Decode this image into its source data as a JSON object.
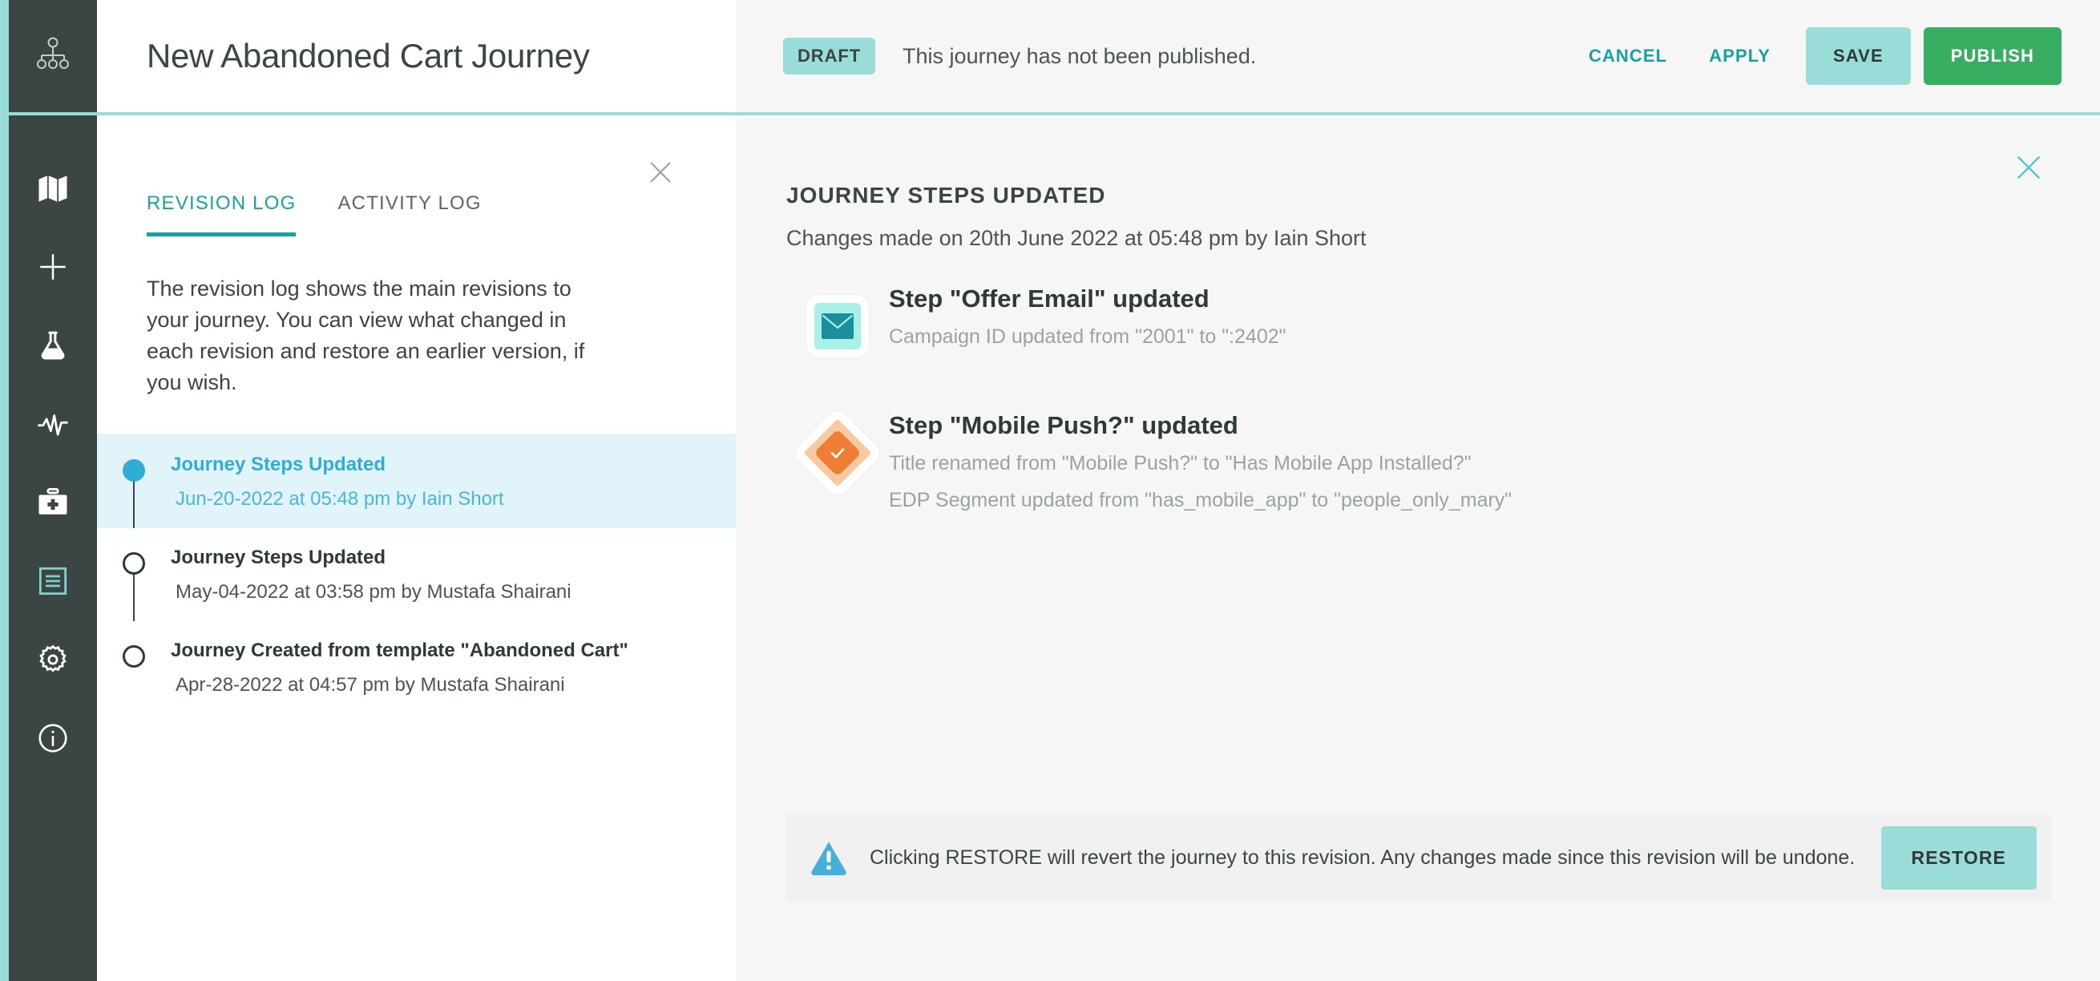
{
  "accent_colors": {
    "teal": "#9adcd8",
    "teal_dark": "#19a0a0",
    "green": "#38ae62",
    "dark": "#3b4544",
    "blue": "#2fadd6",
    "selected_row_bg": "#e1f4fa",
    "orange": "#ef7e35",
    "orange_light": "#f9c9a0"
  },
  "rail": {
    "logo_icon": "org-chart-icon",
    "items": [
      {
        "icon": "map-icon",
        "name": "map",
        "active": false
      },
      {
        "icon": "plus-icon",
        "name": "add",
        "active": false
      },
      {
        "icon": "flask-icon",
        "name": "experiments",
        "active": false
      },
      {
        "icon": "pulse-icon",
        "name": "analytics",
        "active": false
      },
      {
        "icon": "briefcase-medical-icon",
        "name": "toolkit",
        "active": false
      },
      {
        "icon": "log-list-icon",
        "name": "logs",
        "active": true
      },
      {
        "icon": "gear-icon",
        "name": "settings",
        "active": false
      },
      {
        "icon": "info-circle-icon",
        "name": "info",
        "active": false
      }
    ]
  },
  "header": {
    "title": "New Abandoned Cart Journey",
    "status_badge": "DRAFT",
    "publish_note": "This journey has not been published.",
    "cancel_label": "CANCEL",
    "apply_label": "APPLY",
    "save_label": "SAVE",
    "publish_label": "PUBLISH"
  },
  "side_panel": {
    "close_icon": "close-icon",
    "tabs": [
      {
        "label": "REVISION LOG",
        "active": true
      },
      {
        "label": "ACTIVITY LOG",
        "active": false
      }
    ],
    "description": "The revision log shows the main revisions to your journey. You can view what changed in each revision and restore an earlier version, if you wish.",
    "revisions": [
      {
        "title": "Journey Steps Updated",
        "meta": "Jun-20-2022 at 05:48 pm by Iain Short",
        "selected": true
      },
      {
        "title": "Journey Steps Updated",
        "meta": "May-04-2022 at 03:58 pm by Mustafa Shairani",
        "selected": false
      },
      {
        "title": "Journey Created from template \"Abandoned Cart\"",
        "meta": "Apr-28-2022 at 04:57 pm by Mustafa Shairani",
        "selected": false
      }
    ]
  },
  "main": {
    "close_icon": "close-icon",
    "title": "JOURNEY STEPS UPDATED",
    "subtitle": "Changes made on 20th June 2022 at 05:48 pm by Iain Short",
    "changes": [
      {
        "icon": "email-step-icon",
        "title": "Step \"Offer Email\" updated",
        "details": [
          "Campaign ID updated from \"2001\" to \":2402\""
        ]
      },
      {
        "icon": "decision-diamond-icon",
        "title": "Step \"Mobile Push?\" updated",
        "details": [
          "Title renamed from \"Mobile Push?\" to \"Has Mobile App Installed?\"",
          "EDP Segment updated from \"has_mobile_app\" to \"people_only_mary\""
        ]
      }
    ],
    "restore_banner": {
      "icon": "warning-triangle-icon",
      "text": "Clicking RESTORE will revert the journey to this revision. Any changes made since this revision will be undone.",
      "button_label": "RESTORE"
    }
  }
}
